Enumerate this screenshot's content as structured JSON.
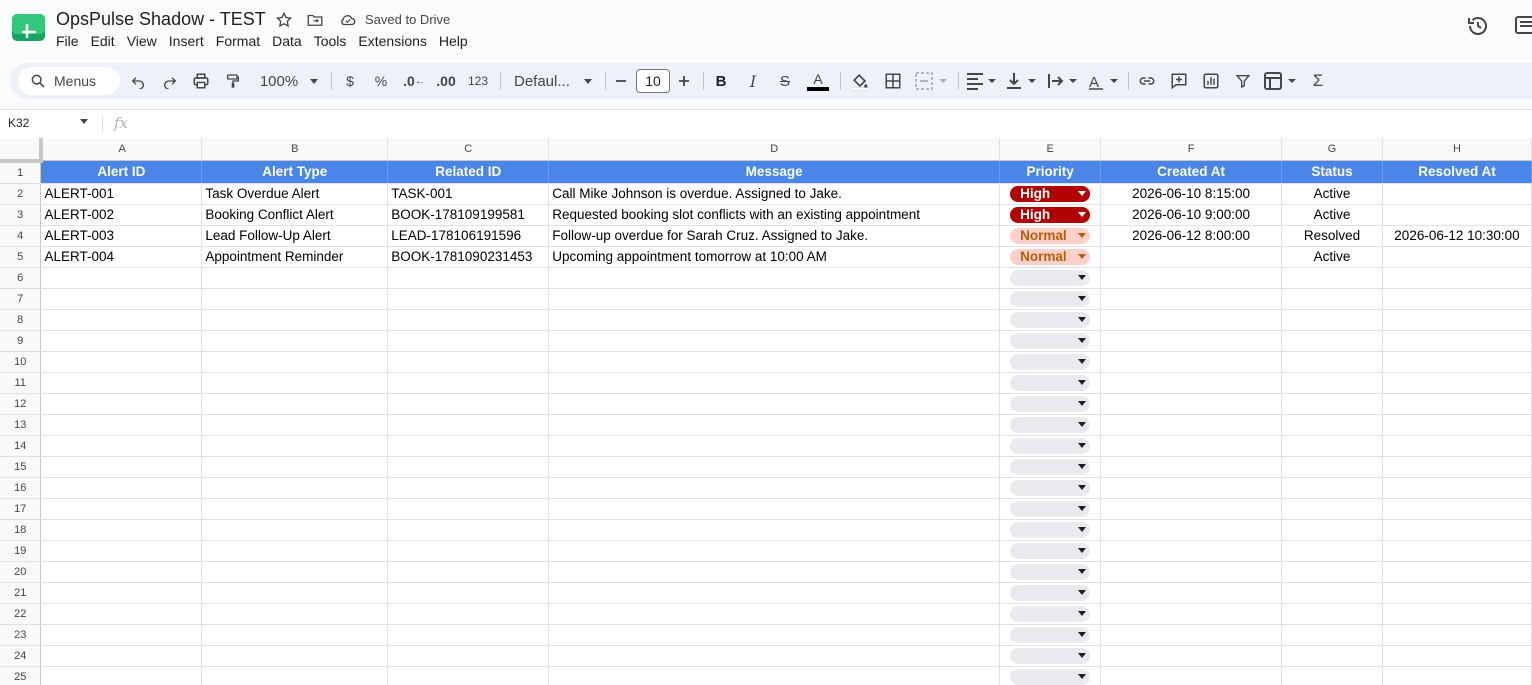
{
  "app": {
    "title": "OpsPulse Shadow - TEST",
    "saved_status": "Saved to Drive",
    "menus": [
      "File",
      "Edit",
      "View",
      "Insert",
      "Format",
      "Data",
      "Tools",
      "Extensions",
      "Help"
    ]
  },
  "toolbar": {
    "search_label": "Menus",
    "zoom": "100%",
    "currency": "$",
    "percent": "%",
    "dec_decrease": ".0",
    "dec_increase": ".00",
    "number_format": "123",
    "font": "Defaul...",
    "font_size": "10"
  },
  "formula_bar": {
    "name_box": "K32",
    "fx": "fx"
  },
  "sheet": {
    "columns": [
      "A",
      "B",
      "C",
      "D",
      "E",
      "F",
      "G",
      "H"
    ],
    "headers": [
      "Alert ID",
      "Alert Type",
      "Related ID",
      "Message",
      "Priority",
      "Created At",
      "Status",
      "Resolved At"
    ],
    "rows": [
      {
        "alert_id": "ALERT-001",
        "alert_type": "Task Overdue Alert",
        "related_id": "TASK-001",
        "message": "Call Mike Johnson is overdue. Assigned to Jake.",
        "priority": "High",
        "created_at": "2026-06-10 8:15:00",
        "status": "Active",
        "resolved_at": ""
      },
      {
        "alert_id": "ALERT-002",
        "alert_type": "Booking Conflict Alert",
        "related_id": "BOOK-178109199581",
        "message": "Requested booking slot conflicts with an existing appointment",
        "priority": "High",
        "created_at": "2026-06-10 9:00:00",
        "status": "Active",
        "resolved_at": ""
      },
      {
        "alert_id": "ALERT-003",
        "alert_type": "Lead Follow-Up Alert",
        "related_id": "LEAD-178106191596",
        "message": "Follow-up overdue for Sarah Cruz. Assigned to Jake.",
        "priority": "Normal",
        "created_at": "2026-06-12 8:00:00",
        "status": "Resolved",
        "resolved_at": "2026-06-12 10:30:00"
      },
      {
        "alert_id": "ALERT-004",
        "alert_type": "Appointment Reminder",
        "related_id": "BOOK-1781090231453",
        "message": "Upcoming appointment tomorrow at 10:00 AM",
        "priority": "Normal",
        "created_at": "",
        "status": "Active",
        "resolved_at": ""
      }
    ],
    "row_numbers": [
      "1",
      "2",
      "3",
      "4",
      "5",
      "6",
      "7",
      "8",
      "9",
      "10",
      "11",
      "12",
      "13",
      "14",
      "15",
      "16",
      "17",
      "18",
      "19",
      "20",
      "21",
      "22",
      "23",
      "24",
      "25"
    ]
  },
  "colors": {
    "header_bg": "#4a86e8",
    "high_bg": "#b10202",
    "normal_bg": "#ffcfc9",
    "normal_text": "#b45f06"
  }
}
